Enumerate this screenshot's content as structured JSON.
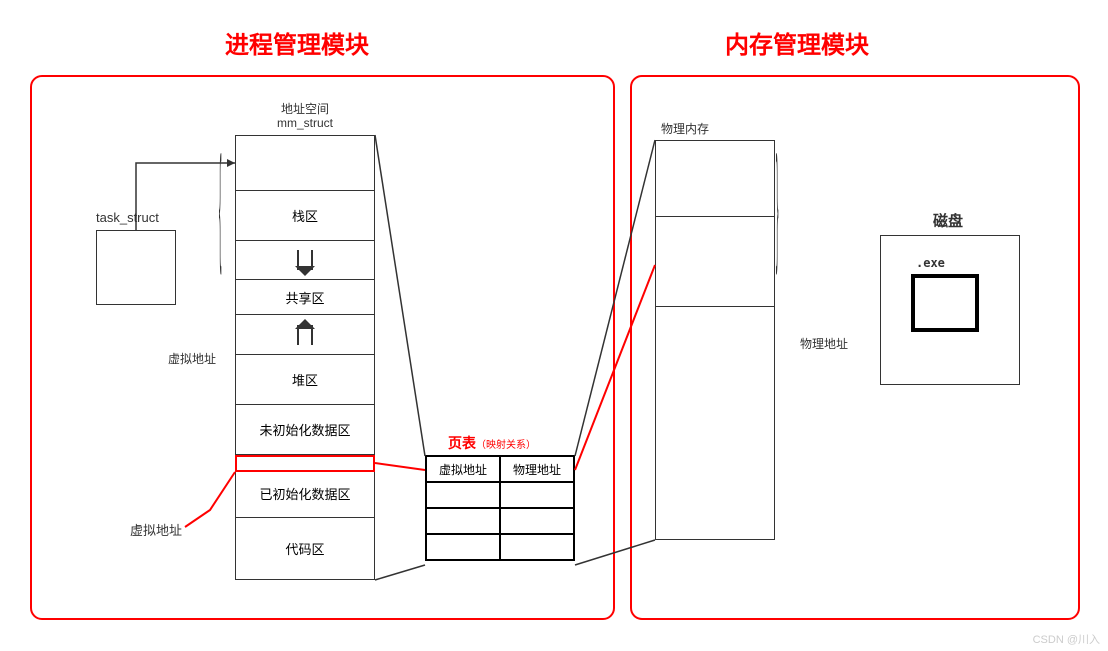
{
  "titles": {
    "process": "进程管理模块",
    "memory": "内存管理模块"
  },
  "process": {
    "task_struct": "task_struct",
    "mm_struct_label1": "地址空间",
    "mm_struct_label2": "mm_struct",
    "vaddr_brace": "虚拟地址",
    "vaddr_callout": "虚拟地址",
    "regions": {
      "stack": "栈区",
      "shared": "共享区",
      "heap": "堆区",
      "bss": "未初始化数据区",
      "data": "已初始化数据区",
      "code": "代码区"
    }
  },
  "page_table": {
    "title": "页表",
    "subtitle": "（映射关系）",
    "col1": "虚拟地址",
    "col2": "物理地址"
  },
  "memory": {
    "phys_mem": "物理内存",
    "phys_addr": "物理地址",
    "disk": "磁盘",
    "exe": ".exe"
  },
  "watermark": "CSDN @川入"
}
